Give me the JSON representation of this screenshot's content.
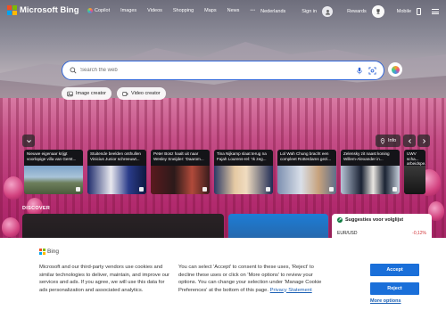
{
  "header": {
    "brand": "Microsoft Bing",
    "nav": [
      {
        "label": "Copilot",
        "icon": "copilot-icon"
      },
      {
        "label": "Images"
      },
      {
        "label": "Videos"
      },
      {
        "label": "Shopping"
      },
      {
        "label": "Maps"
      },
      {
        "label": "News"
      },
      {
        "label": "•••"
      }
    ],
    "region": "Nederlands",
    "sign_in": "Sign in",
    "rewards": "Rewards",
    "mobile": "Mobile"
  },
  "search": {
    "placeholder": "Search the web"
  },
  "pills": {
    "image_creator": "Image creator",
    "video_creator": "Video creator"
  },
  "carousel": {
    "info_label": "Info"
  },
  "news_cards": [
    {
      "title": "Nieuwe eigenaar krijgt voorlopige villa van Gerst..."
    },
    {
      "title": "Stuitende beelden onthullen Vinicius Junior schreeuwt..."
    },
    {
      "title": "Peter Bosz haalt uit naar Wesley Sneijder: 'Daarom..."
    },
    {
      "title": "Tina Nijkamp slaat terug na Fajah Lourens-rel: 'Ik zeg..."
    },
    {
      "title": "Lol Wah Chung bracht een compleet Rotterdams gezi..."
    },
    {
      "title": "Zelensky zit naast koning Willem-Alexander in..."
    },
    {
      "title": "UWV scha... arbeidspe..."
    }
  ],
  "discover": {
    "label": "DISCOVER",
    "sidebar_title": "Suggesties voor volglijst",
    "stock_symbol": "EUR/USD",
    "stock_change": "-0,12%"
  },
  "cookie": {
    "brand": "Bing",
    "text_a": "Microsoft and our third-party vendors use cookies and similar technologies to deliver, maintain, and improve our services and ads. If you agree, we will use this data for ads personalization and associated analytics.",
    "text_b": "You can select 'Accept' to consent to these uses, 'Reject' to decline these uses or click on 'More options' to review your options. You can change your selection under 'Manage Cookie Preferences' at the bottom of this page.",
    "privacy_link": "Privacy Statement",
    "accept": "Accept",
    "reject": "Reject",
    "more_options": "More options"
  },
  "colors": {
    "accent": "#1a6fd9",
    "search_border": "#2f65d8",
    "stock_down": "#d13438"
  }
}
